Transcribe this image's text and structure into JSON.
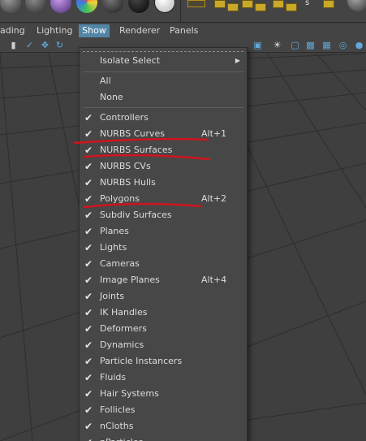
{
  "menubar": {
    "items": [
      {
        "label": "ading"
      },
      {
        "label": "Lighting"
      },
      {
        "label": "Show"
      },
      {
        "label": "Renderer"
      },
      {
        "label": "Panels"
      }
    ]
  },
  "toolbar_icons": [
    "bookmark-icon",
    "select-camera-icon",
    "camera-move-icon",
    "tumble-icon",
    "film-gate-icon",
    "lighting-icon",
    "shaded-icon",
    "wireframe-icon"
  ],
  "show_menu": {
    "isolate_select": "Isolate Select",
    "all": "All",
    "none": "None",
    "items": [
      {
        "label": "Controllers",
        "checked": true,
        "shortcut": ""
      },
      {
        "label": "NURBS Curves",
        "checked": true,
        "shortcut": "Alt+1"
      },
      {
        "label": "NURBS Surfaces",
        "checked": true,
        "shortcut": ""
      },
      {
        "label": "NURBS CVs",
        "checked": true,
        "shortcut": ""
      },
      {
        "label": "NURBS Hulls",
        "checked": true,
        "shortcut": ""
      },
      {
        "label": "Polygons",
        "checked": true,
        "shortcut": "Alt+2"
      },
      {
        "label": "Subdiv Surfaces",
        "checked": true,
        "shortcut": ""
      },
      {
        "label": "Planes",
        "checked": true,
        "shortcut": ""
      },
      {
        "label": "Lights",
        "checked": true,
        "shortcut": ""
      },
      {
        "label": "Cameras",
        "checked": true,
        "shortcut": ""
      },
      {
        "label": "Image Planes",
        "checked": true,
        "shortcut": "Alt+4"
      },
      {
        "label": "Joints",
        "checked": true,
        "shortcut": ""
      },
      {
        "label": "IK Handles",
        "checked": true,
        "shortcut": ""
      },
      {
        "label": "Deformers",
        "checked": true,
        "shortcut": ""
      },
      {
        "label": "Dynamics",
        "checked": true,
        "shortcut": ""
      },
      {
        "label": "Particle Instancers",
        "checked": true,
        "shortcut": ""
      },
      {
        "label": "Fluids",
        "checked": true,
        "shortcut": ""
      },
      {
        "label": "Hair Systems",
        "checked": true,
        "shortcut": ""
      },
      {
        "label": "Follicles",
        "checked": true,
        "shortcut": ""
      },
      {
        "label": "nCloths",
        "checked": true,
        "shortcut": ""
      },
      {
        "label": "nParticles",
        "checked": true,
        "shortcut": ""
      }
    ]
  },
  "colors": {
    "menu_active": "#5285a6",
    "annotation": "#d0131f",
    "menu_bg": "#474747",
    "viewport_bg": "#3f3f3f"
  }
}
